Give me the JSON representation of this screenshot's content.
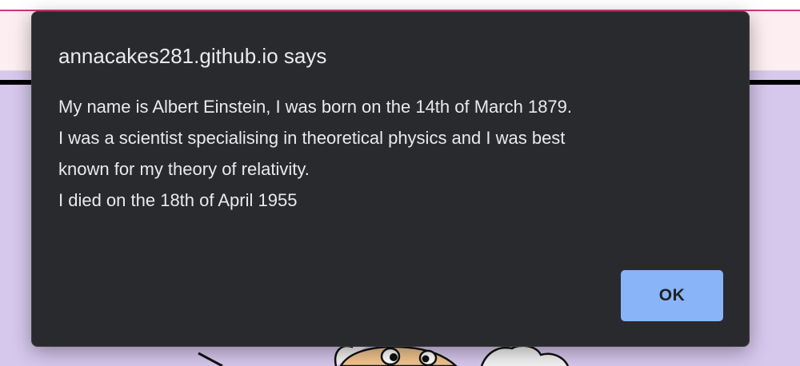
{
  "dialog": {
    "title": "annacakes281.github.io says",
    "message_lines": [
      "My name is Albert Einstein, I was born on the 14th of March 1879.",
      "I was a scientist specialising in theoretical physics and I was best",
      "known for my theory of relativity.",
      "I died on the 18th of April 1955"
    ],
    "ok_label": "OK"
  },
  "colors": {
    "dialog_background": "#292a2d",
    "dialog_text": "#e8eaed",
    "button_background": "#8ab4f8",
    "page_background": "#d6c7ec",
    "page_accent": "#d6337e"
  },
  "icons": {
    "background_illustration": "cartoon-einstein-illustration"
  }
}
